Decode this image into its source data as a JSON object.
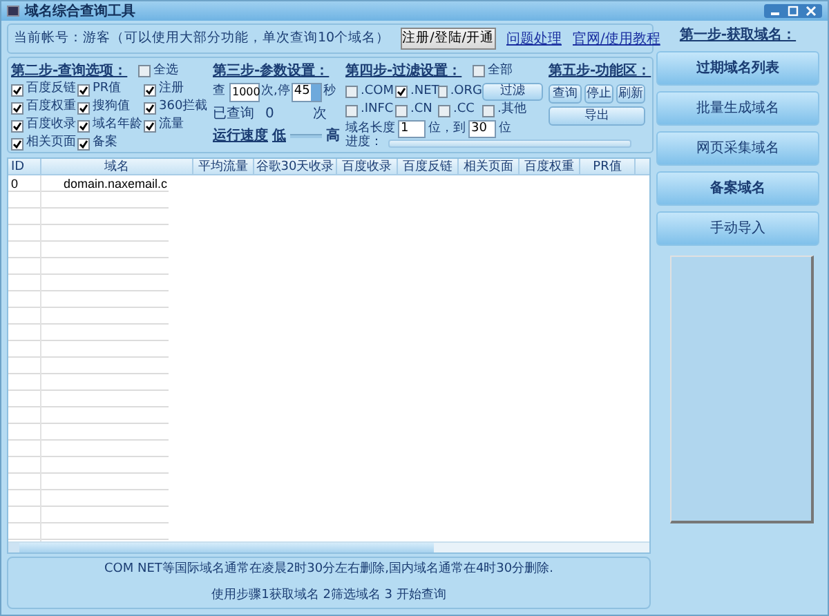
{
  "window": {
    "title": "域名综合查询工具"
  },
  "account": {
    "text": "当前帐号：游客（可以使用大部分功能，单次查询10个域名）",
    "register_button": "注册/登陆/开通",
    "links": [
      "问题处理",
      "官网/使用教程"
    ]
  },
  "step2": {
    "title": "第二步-查询选项：",
    "select_all": {
      "label": "全选",
      "checked": false
    },
    "options": [
      {
        "label": "百度反链",
        "checked": true
      },
      {
        "label": "PR值",
        "checked": true
      },
      {
        "label": "注册",
        "checked": true
      },
      {
        "label": "百度权重",
        "checked": true
      },
      {
        "label": "搜狗值",
        "checked": true
      },
      {
        "label": "360拦截",
        "checked": true
      },
      {
        "label": "百度收录",
        "checked": true
      },
      {
        "label": "域名年龄",
        "checked": true
      },
      {
        "label": "流量",
        "checked": true
      },
      {
        "label": "相关页面",
        "checked": true
      },
      {
        "label": "备案",
        "checked": true
      }
    ]
  },
  "step3": {
    "title": "第三步-参数设置：",
    "query_label": "查",
    "query_value": "1000",
    "pause_label": "次,停",
    "pause_value": "45",
    "seconds_label": "秒",
    "done_label": "已查询",
    "done_count": "0",
    "done_unit": "次",
    "speed_label": "运行速度",
    "speed_low": "低",
    "speed_high": "高"
  },
  "step4": {
    "title": "第四步-过滤设置：",
    "all": {
      "label": "全部",
      "checked": false
    },
    "filter_button": "过滤",
    "tlds": [
      {
        "label": ".COM",
        "checked": false
      },
      {
        "label": ".NET",
        "checked": true
      },
      {
        "label": ".ORG",
        "checked": false
      },
      {
        "label": ".INFC",
        "checked": false
      },
      {
        "label": ".CN",
        "checked": false
      },
      {
        "label": ".CC",
        "checked": false
      },
      {
        "label": ".其他",
        "checked": false
      }
    ],
    "length_label": "域名长度",
    "length_from": "1",
    "to_label": "位，到",
    "length_to": "30",
    "unit": "位",
    "progress_label": "进度：",
    "progress": {
      "level": 0
    }
  },
  "step5": {
    "title": "第五步-功能区：",
    "buttons": [
      "查询",
      "停止",
      "刷新"
    ],
    "export_button": "导出"
  },
  "table": {
    "columns": [
      "ID",
      "域名",
      "平均流量",
      "谷歌30天收录",
      "百度收录",
      "百度反链",
      "相关页面",
      "百度权重",
      "PR值"
    ],
    "rows": [
      {
        "cells": [
          "0",
          "domain.naxemail.c"
        ]
      }
    ]
  },
  "sidebar": {
    "title": "第一步-获取域名：",
    "buttons": [
      {
        "label": "过期域名列表",
        "bold": true
      },
      {
        "label": "批量生成域名",
        "bold": false
      },
      {
        "label": "网页采集域名",
        "bold": false
      },
      {
        "label": "备案域名",
        "bold": true
      },
      {
        "label": "手动导入",
        "bold": false
      }
    ]
  },
  "notes": [
    "COM NET等国际域名通常在凌晨2时30分左右删除,国内域名通常在4时30分删除.",
    "使用步骤1获取域名 2筛选域名 3 开始查询"
  ]
}
